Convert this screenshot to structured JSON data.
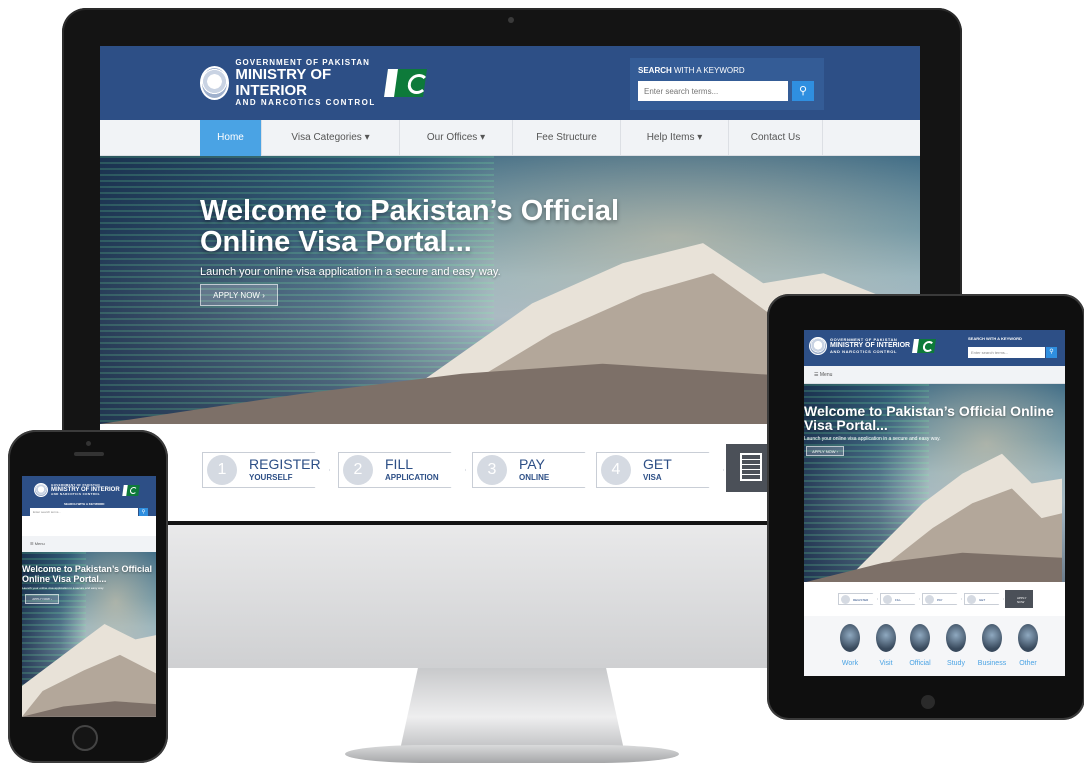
{
  "site": {
    "logo": {
      "line1": "GOVERNMENT OF PAKISTAN",
      "line2": "MINISTRY OF INTERIOR",
      "line3": "AND NARCOTICS CONTROL"
    },
    "search": {
      "label_bold": "SEARCH",
      "label_rest": " WITH A KEYWORD",
      "placeholder": "Enter search terms...",
      "button_icon": "search-icon"
    },
    "nav": [
      "Home",
      "Visa Categories ▾",
      "Our Offices ▾",
      "Fee Structure",
      "Help Items ▾",
      "Contact Us"
    ],
    "menu_label": "☰  Menu",
    "hero": {
      "title": "Welcome to Pakistan’s Official Online Visa Portal...",
      "subtitle": "Launch your online visa application in a secure and easy way.",
      "button": "APPLY NOW ›"
    },
    "steps": [
      {
        "num": "1",
        "title": "REGISTER",
        "sub": "YOURSELF"
      },
      {
        "num": "2",
        "title": "FILL",
        "sub": "APPLICATION"
      },
      {
        "num": "3",
        "title": "PAY",
        "sub": "ONLINE"
      },
      {
        "num": "4",
        "title": "GET",
        "sub": "VISA"
      }
    ],
    "apply_label": "APPLY NOW",
    "categories": [
      "Work",
      "Visit",
      "Official",
      "Study",
      "Business",
      "Other"
    ]
  },
  "colors": {
    "header_bg": "#2d4f86",
    "nav_active": "#4aa3e4",
    "search_button": "#2f8fe0",
    "flag_green": "#0d7a3a"
  }
}
